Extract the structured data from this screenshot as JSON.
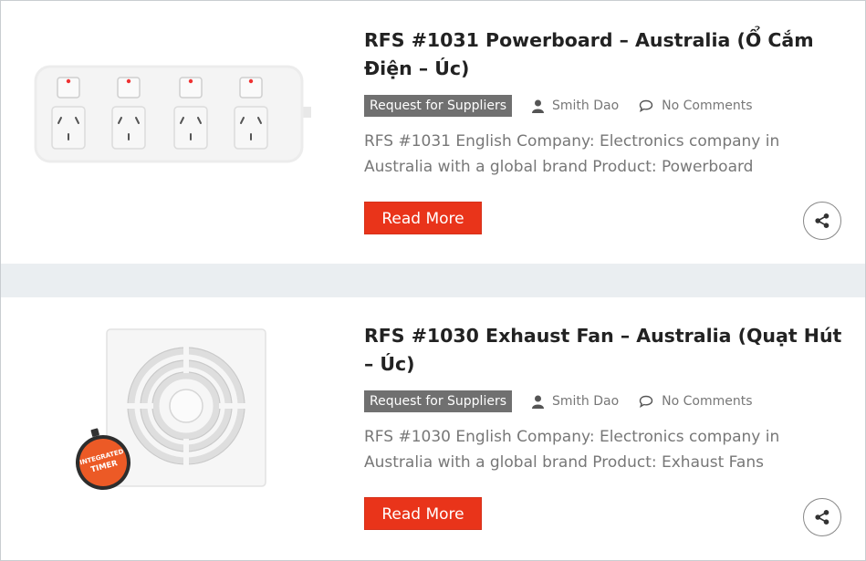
{
  "posts": [
    {
      "title": "RFS #1031 Powerboard – Australia (Ổ Cắm Điện – Úc)",
      "category": "Request for Suppliers",
      "author": "Smith Dao",
      "comments": "No Comments",
      "excerpt": "RFS #1031 English Company: Electronics company in Australia with a global brand Product: Powerboard",
      "read_more": "Read More",
      "image_icon": "powerboard-image"
    },
    {
      "title": "RFS #1030 Exhaust Fan – Australia (Quạt Hút – Úc)",
      "category": "Request for Suppliers",
      "author": "Smith Dao",
      "comments": "No Comments",
      "excerpt": "RFS #1030 English Company: Electronics company in Australia with a global brand Product: Exhaust Fans",
      "read_more": "Read More",
      "image_icon": "exhaust-fan-image",
      "badge_text": [
        "INTEGRATED",
        "TIMER"
      ]
    }
  ],
  "colors": {
    "accent": "#e9341a",
    "category_bg": "#707070",
    "separator": "#eaeef1",
    "meta_text": "#777777",
    "title_text": "#222222"
  },
  "icons": {
    "author": "user-icon",
    "comments": "comment-bubble-icon",
    "share": "share-icon"
  }
}
